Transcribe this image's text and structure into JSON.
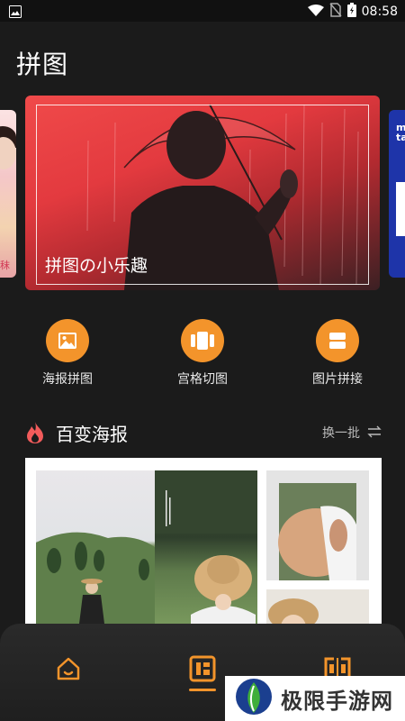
{
  "status_bar": {
    "time": "08:58",
    "battery_glyph": "B"
  },
  "header": {
    "title": "拼图"
  },
  "banner": {
    "caption": "拼图の小乐趣",
    "left_peek_text": "秣",
    "right_peek_text": "m\nta"
  },
  "tools": [
    {
      "label": "海报拼图",
      "icon": "image-icon"
    },
    {
      "label": "宫格切图",
      "icon": "grid-cut-icon"
    },
    {
      "label": "图片拼接",
      "icon": "stitch-icon"
    }
  ],
  "section": {
    "title": "百变海报",
    "action": "换一批",
    "icon": "flame-icon"
  },
  "bottom_nav": [
    {
      "name": "home",
      "icon": "home-icon"
    },
    {
      "name": "template",
      "icon": "layout-icon",
      "active": true
    },
    {
      "name": "stitch",
      "icon": "stitch-nav-icon"
    }
  ],
  "watermark": {
    "text": "极限手游网"
  },
  "colors": {
    "accent": "#f3942b",
    "background": "#1b1b1b",
    "flame": "#f25b5b"
  }
}
